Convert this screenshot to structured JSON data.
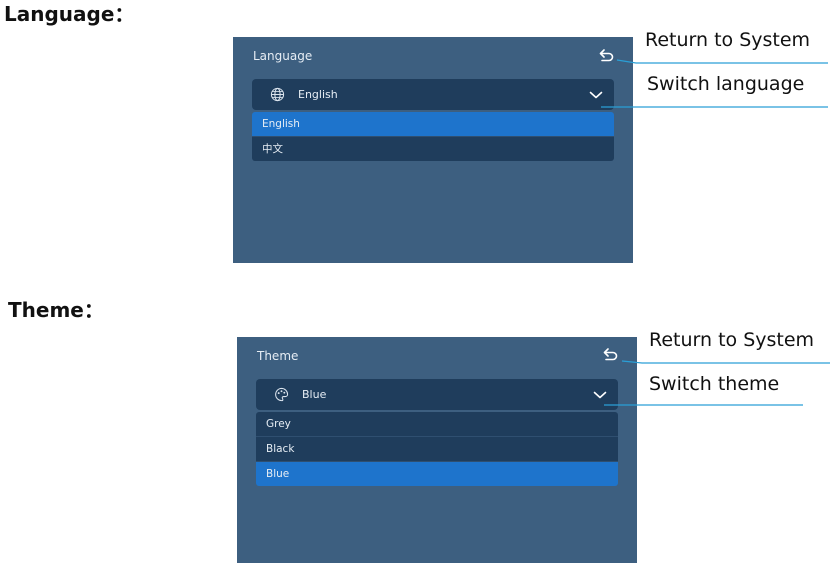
{
  "language": {
    "heading": "Language：",
    "panel_title": "Language",
    "selected_value": "English",
    "options": [
      "English",
      "中文"
    ],
    "selected_option": "English",
    "icon": "globe-icon",
    "callout_return": "Return to System",
    "callout_switch": "Switch language"
  },
  "theme": {
    "heading": "Theme：",
    "panel_title": "Theme",
    "selected_value": "Blue",
    "options": [
      "Grey",
      "Black",
      "Blue"
    ],
    "selected_option": "Blue",
    "icon": "palette-icon",
    "callout_return": "Return to System",
    "callout_switch": "Switch theme"
  },
  "colors": {
    "panel_bg": "#3d5f80",
    "select_bg": "#1f3d5c",
    "selected_option": "#1e74cc",
    "callout_line": "#2a9fd6"
  }
}
